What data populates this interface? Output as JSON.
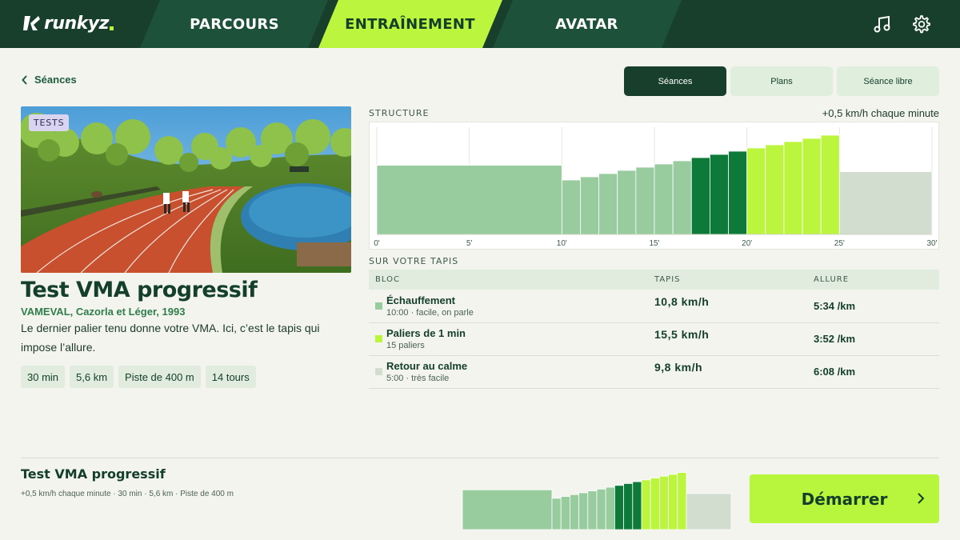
{
  "app": {
    "logo_text": "runkyz"
  },
  "nav": {
    "tabs": [
      {
        "label": "PARCOURS",
        "active": false
      },
      {
        "label": "ENTRAÎNEMENT",
        "active": true
      },
      {
        "label": "AVATAR",
        "active": false
      }
    ],
    "icons": [
      "music-icon",
      "gear-icon"
    ]
  },
  "back_label": "Séances",
  "segments": [
    {
      "label": "Séances",
      "active": true
    },
    {
      "label": "Plans",
      "active": false
    },
    {
      "label": "Séance libre",
      "active": false
    }
  ],
  "session": {
    "badge": "TESTS",
    "title": "Test VMA progressif",
    "subtitle": "VAMEVAL, Cazorla et Léger, 1993",
    "description": "Le dernier palier tenu donne votre VMA. Ici, c’est le tapis qui impose l’allure.",
    "chips": [
      "30 min",
      "5,6 km",
      "Piste de 400 m",
      "14 tours"
    ]
  },
  "structure": {
    "label": "STRUCTURE",
    "note": "+0,5 km/h chaque minute",
    "x_ticks": [
      "0'",
      "5'",
      "10'",
      "15'",
      "20'",
      "25'",
      "30'"
    ]
  },
  "chart_data": {
    "type": "bar",
    "title": "STRUCTURE",
    "x_unit": "minutes",
    "xlim": [
      0,
      30
    ],
    "x_ticks": [
      "0'",
      "5'",
      "10'",
      "15'",
      "20'",
      "25'",
      "30'"
    ],
    "blocks": [
      {
        "start": 0,
        "end": 10,
        "speed": 10.8,
        "kind": "warmup"
      },
      {
        "start": 10,
        "end": 11,
        "speed": 8.5,
        "kind": "step-light"
      },
      {
        "start": 11,
        "end": 12,
        "speed": 9.0,
        "kind": "step-light"
      },
      {
        "start": 12,
        "end": 13,
        "speed": 9.5,
        "kind": "step-light"
      },
      {
        "start": 13,
        "end": 14,
        "speed": 10.0,
        "kind": "step-light"
      },
      {
        "start": 14,
        "end": 15,
        "speed": 10.5,
        "kind": "step-light"
      },
      {
        "start": 15,
        "end": 16,
        "speed": 11.0,
        "kind": "step-light"
      },
      {
        "start": 16,
        "end": 17,
        "speed": 11.5,
        "kind": "step-light"
      },
      {
        "start": 17,
        "end": 18,
        "speed": 12.0,
        "kind": "step-dark"
      },
      {
        "start": 18,
        "end": 19,
        "speed": 12.5,
        "kind": "step-dark"
      },
      {
        "start": 19,
        "end": 20,
        "speed": 13.0,
        "kind": "step-dark"
      },
      {
        "start": 20,
        "end": 21,
        "speed": 13.5,
        "kind": "step-lime"
      },
      {
        "start": 21,
        "end": 22,
        "speed": 14.0,
        "kind": "step-lime"
      },
      {
        "start": 22,
        "end": 23,
        "speed": 14.5,
        "kind": "step-lime"
      },
      {
        "start": 23,
        "end": 24,
        "speed": 15.0,
        "kind": "step-lime"
      },
      {
        "start": 24,
        "end": 25,
        "speed": 15.5,
        "kind": "step-lime"
      },
      {
        "start": 25,
        "end": 30,
        "speed": 9.8,
        "kind": "cooldown"
      }
    ],
    "ylim": [
      0,
      16.5
    ],
    "colors": {
      "warmup": "#98cc9f",
      "step-light": "#98cc9f",
      "step-dark": "#0d7a39",
      "step-lime": "#bcf53d",
      "cooldown": "#d2dccf"
    }
  },
  "table": {
    "label": "SUR VOTRE TAPIS",
    "headers": {
      "bloc": "BLOC",
      "tapis": "TAPIS",
      "allure": "ALLURE"
    },
    "rows": [
      {
        "name": "Échauffement",
        "meta": "10:00 · facile, on parle",
        "speed": "10,8 km/h",
        "pace": "5:34 /km",
        "color": "#98cc9f"
      },
      {
        "name": "Paliers de 1 min",
        "meta": "15 paliers",
        "speed": "15,5 km/h",
        "pace": "3:52 /km",
        "color": "#bcf53d"
      },
      {
        "name": "Retour au calme",
        "meta": "5:00 · très facile",
        "speed": "9,8 km/h",
        "pace": "6:08 /km",
        "color": "#d2dccf"
      }
    ]
  },
  "footer": {
    "title": "Test VMA progressif",
    "meta": "+0,5 km/h chaque minute · 30 min · 5,6 km · Piste de 400 m",
    "start_label": "Démarrer"
  }
}
